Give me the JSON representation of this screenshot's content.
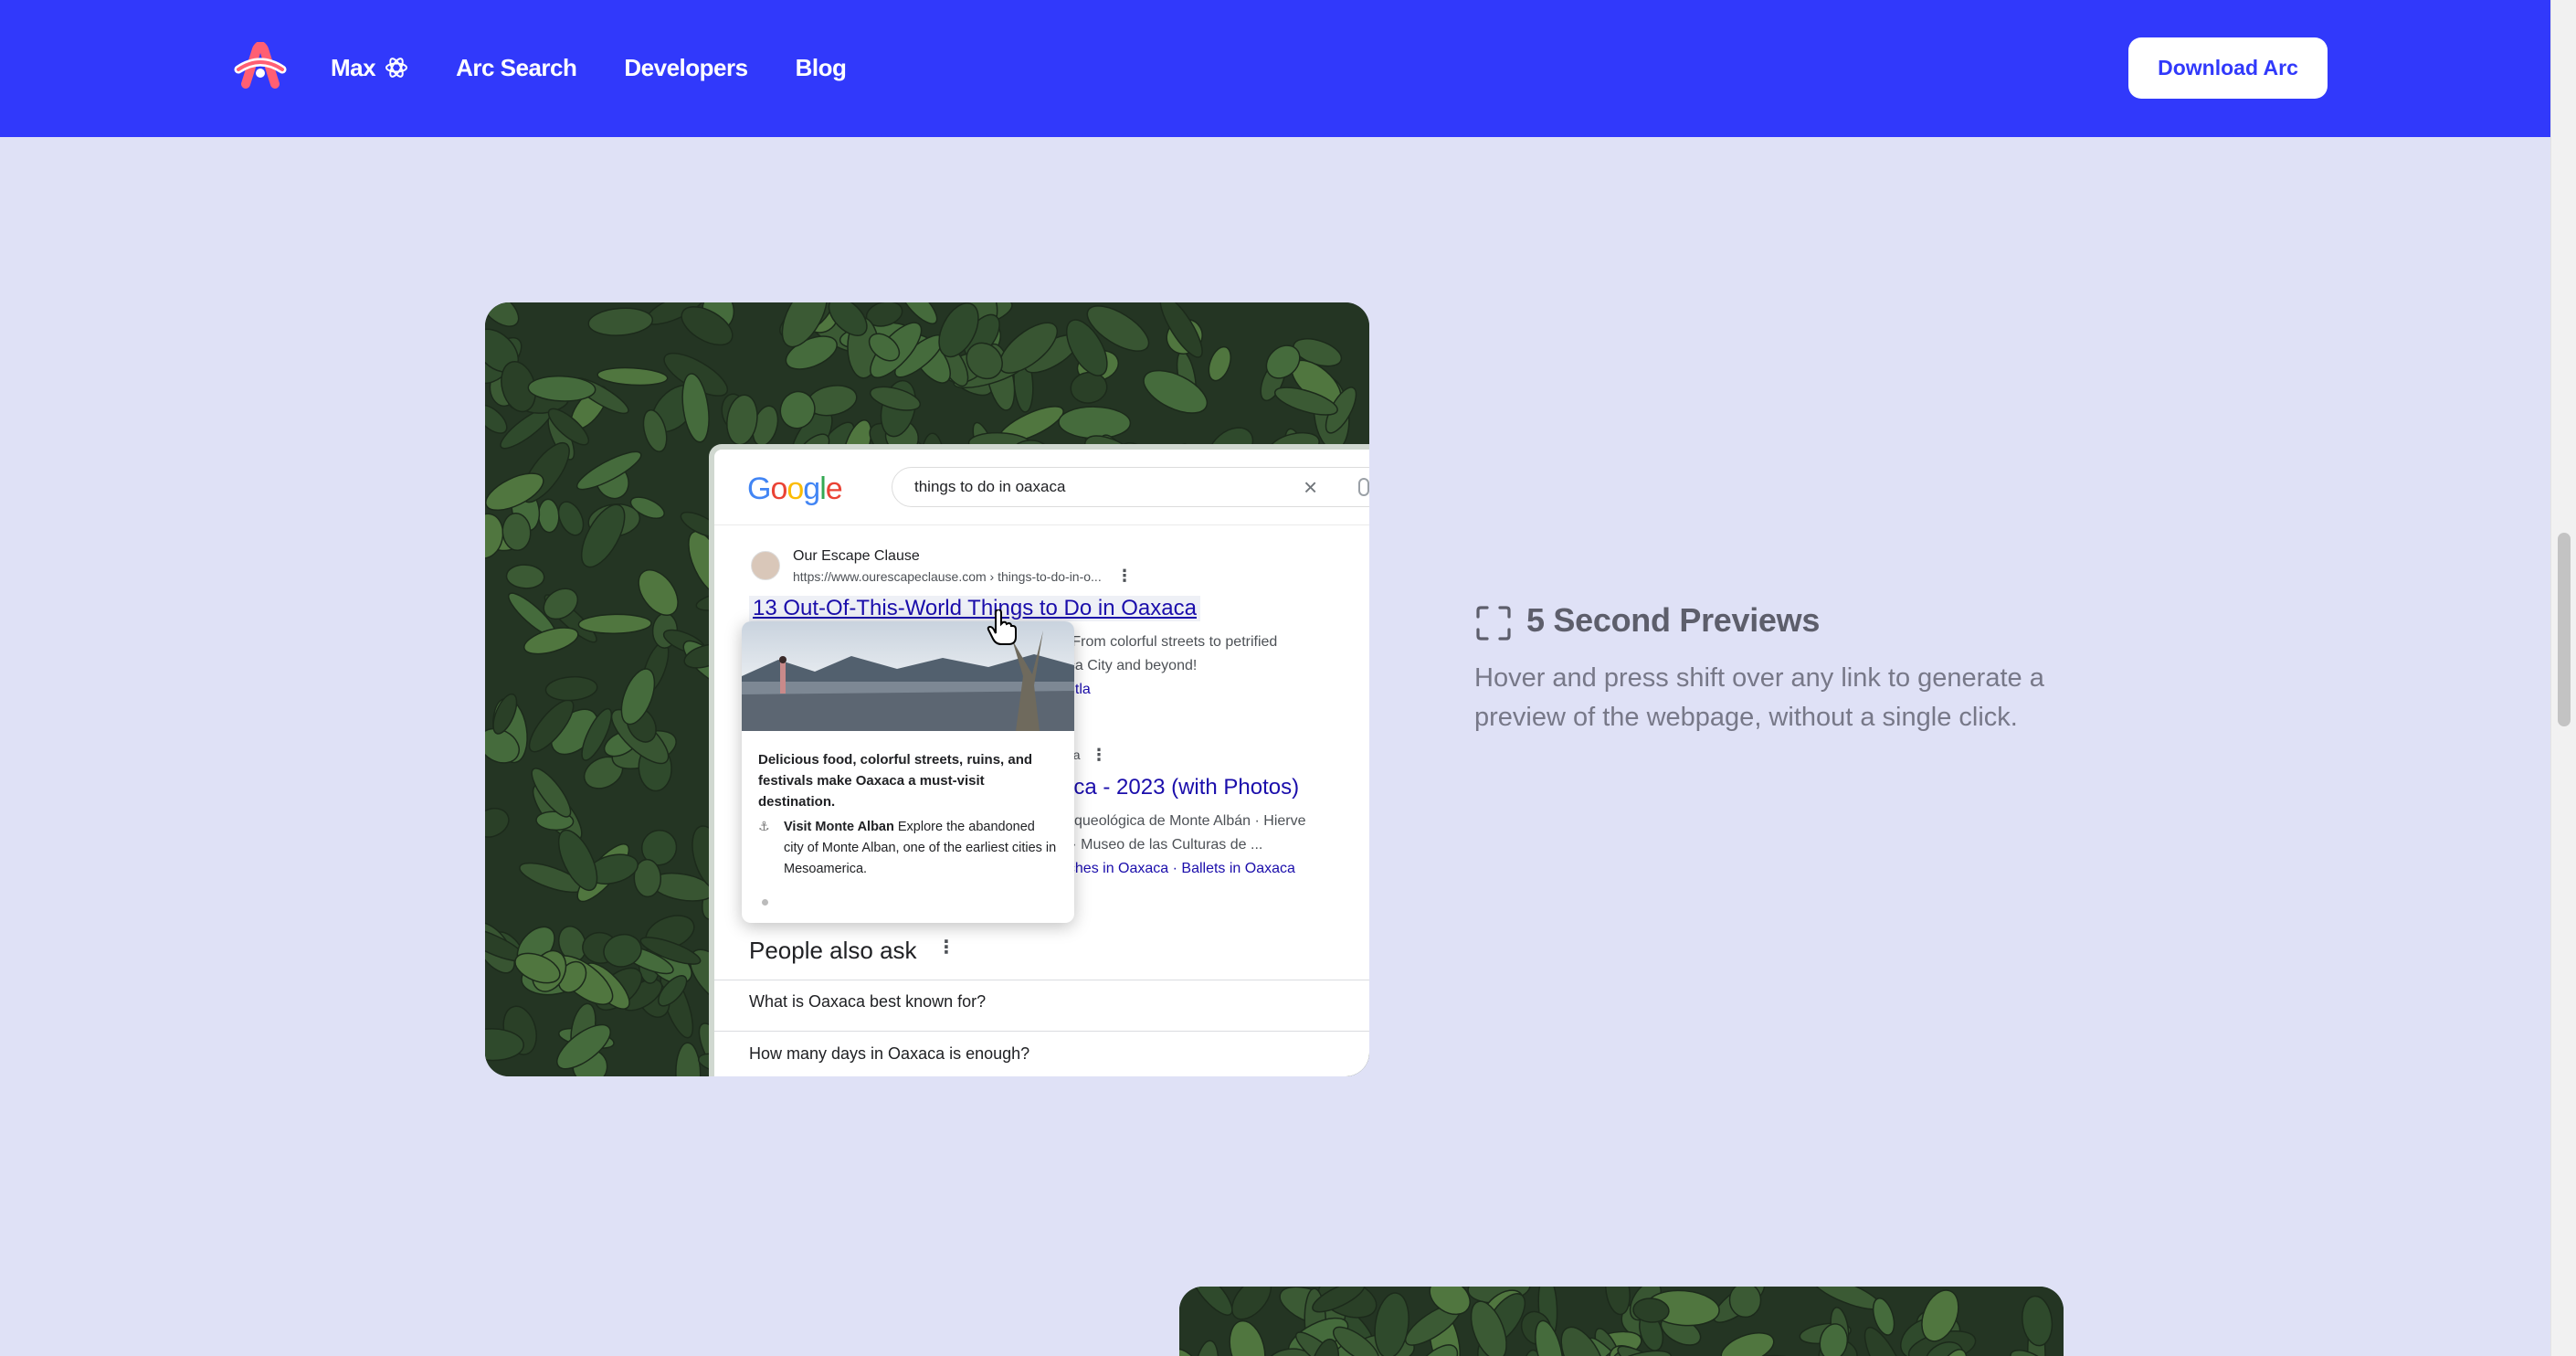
{
  "header": {
    "logo_name": "arc-logo",
    "nav": [
      {
        "label": "Max",
        "icon": "atom-icon"
      },
      {
        "label": "Arc Search"
      },
      {
        "label": "Developers"
      },
      {
        "label": "Blog"
      }
    ],
    "download_label": "Download Arc",
    "bg_color": "#3139fb"
  },
  "browser_mock": {
    "google_logo": [
      "G",
      "o",
      "o",
      "g",
      "l",
      "e"
    ],
    "search_query": "things to do in oaxaca",
    "result1": {
      "site": "Our Escape Clause",
      "url": "https://www.ourescapeclause.com › things-to-do-in-o...",
      "title": "13 Out-Of-This-World Things to Do in Oaxaca",
      "snippet1": "? From colorful streets to petrified",
      "snippet2": "aca City and beyond!",
      "snippet3": "Mitla"
    },
    "result2": {
      "site_tail": "aca",
      "title": "aca - 2023 (with Photos)",
      "snippet1": "Arqueológica de Monte Albán · Hierve",
      "snippet2": "a · Museo de las Culturas de ...",
      "snippet3": "aches in Oaxaca · Ballets in Oaxaca"
    },
    "preview": {
      "headline": "Delicious food, colorful streets, ruins, and festivals make Oaxaca a must-visit destination.",
      "item_bold": "Visit Monte Alban",
      "item_text": " Explore the abandoned city of Monte Alban, one of the earliest cities in Mesoamerica."
    },
    "people_also_ask": {
      "title": "People also ask",
      "questions": [
        "What is Oaxaca best known for?",
        "How many days in Oaxaca is enough?"
      ]
    }
  },
  "feature": {
    "icon": "expand-corners-icon",
    "title": "5 Second Previews",
    "description": "Hover and press shift over any link to generate a preview of the webpage, without a single click."
  }
}
